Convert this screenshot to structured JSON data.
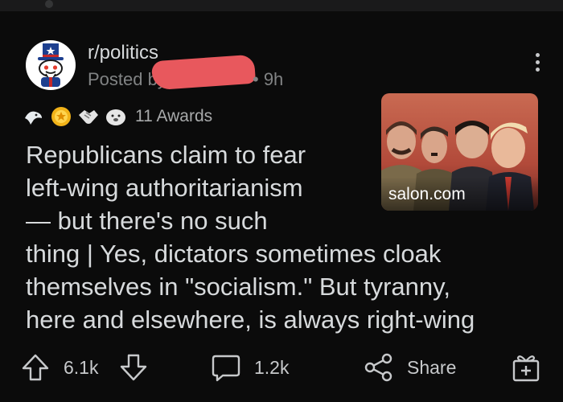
{
  "post": {
    "subreddit": "r/politics",
    "posted_prefix": "Posted by",
    "age": "• 9h",
    "awards_count": "11 Awards",
    "title_lines": [
      "Republicans claim to fear",
      "left-wing authoritarianism",
      "— but there's no such",
      "thing | Yes, dictators sometimes cloak",
      "themselves in \"socialism.\" But tyranny,",
      "here and elsewhere, is always right-wing"
    ],
    "thumbnail_domain": "salon.com"
  },
  "actions": {
    "upvotes": "6.1k",
    "comments": "1.2k",
    "share_label": "Share"
  },
  "icons": {
    "avatar": "subreddit-avatar-icon",
    "upvote": "upvote-arrow-icon",
    "downvote": "downvote-arrow-icon",
    "comment": "comment-bubble-icon",
    "share": "share-icon",
    "award": "award-gift-icon",
    "more": "more-options-icon"
  },
  "colors": {
    "background": "#0b0b0b",
    "text": "#d7dadc",
    "muted": "#818384",
    "redaction": "#e8585d"
  }
}
